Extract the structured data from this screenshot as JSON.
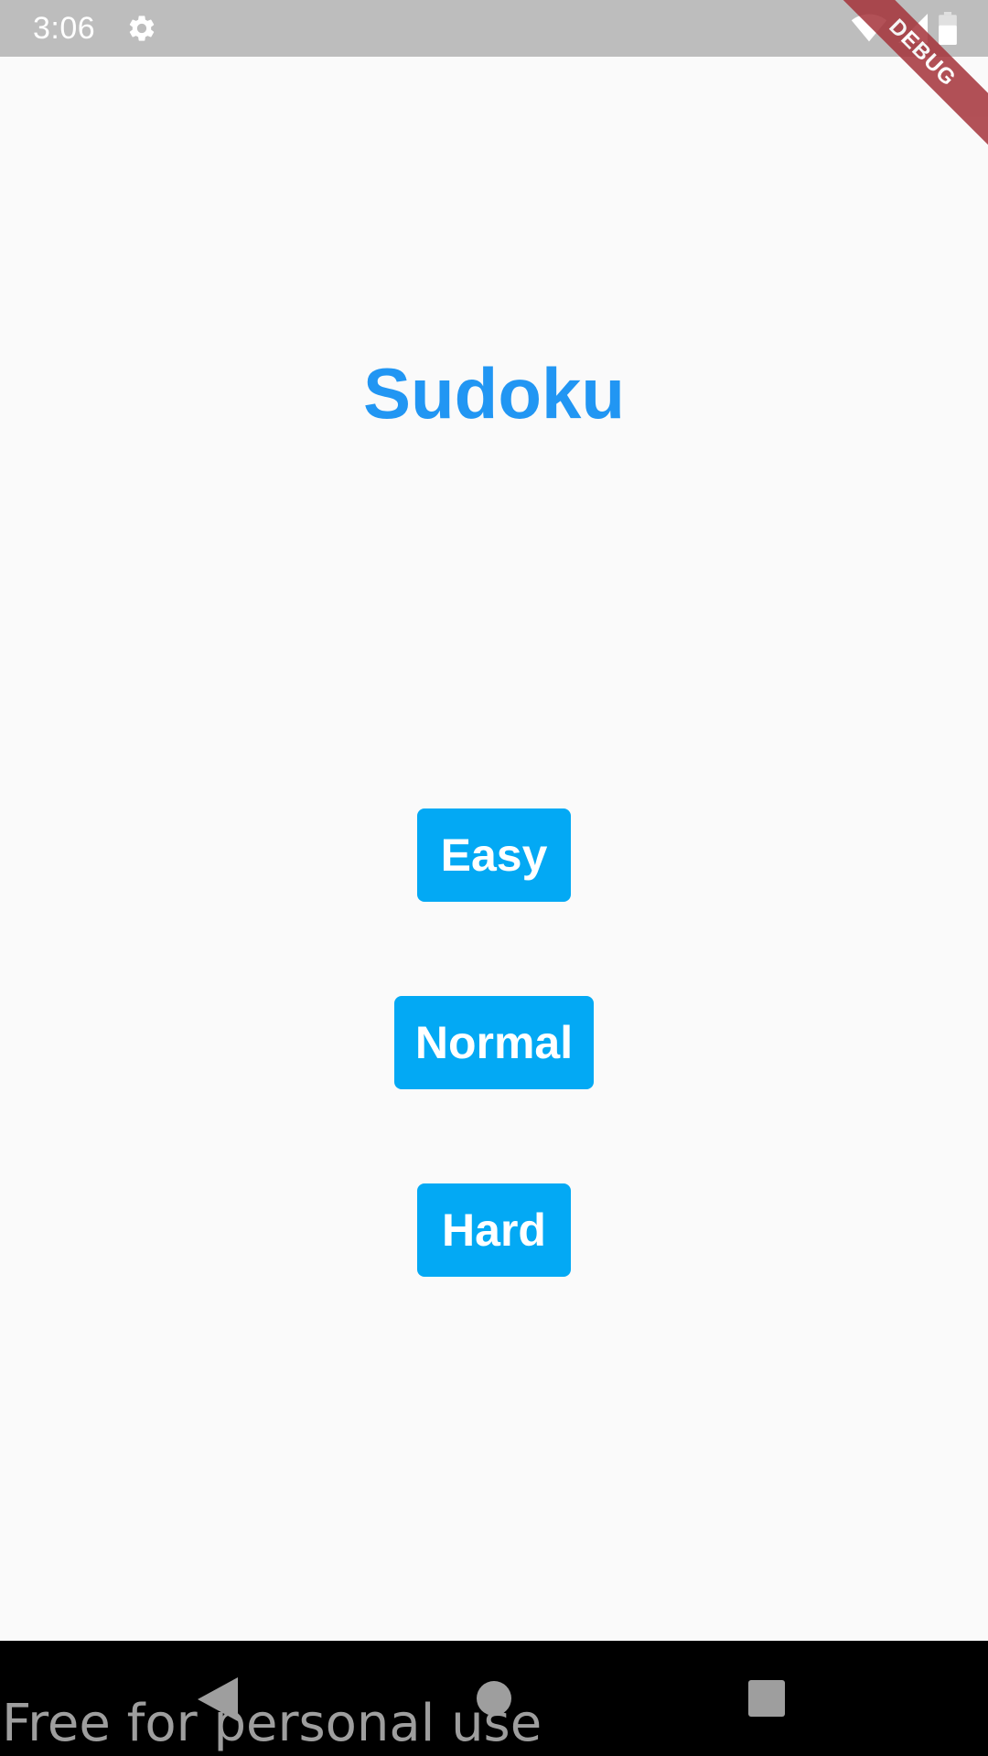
{
  "status_bar": {
    "time": "3:06",
    "icons": [
      "gear-icon",
      "wifi-icon",
      "cellular-signal-icon",
      "battery-icon"
    ]
  },
  "debug_banner": {
    "label": "DEBUG",
    "color": "#a5333a"
  },
  "app": {
    "title": "Sudoku",
    "title_color": "#2196f3",
    "button_color": "#03a9f4",
    "buttons": [
      {
        "label": "Easy"
      },
      {
        "label": "Normal"
      },
      {
        "label": "Hard"
      }
    ]
  },
  "nav_bar": {
    "icons": [
      "back-icon",
      "home-icon",
      "recents-icon"
    ]
  },
  "watermark": {
    "text": "Free for personal use"
  }
}
